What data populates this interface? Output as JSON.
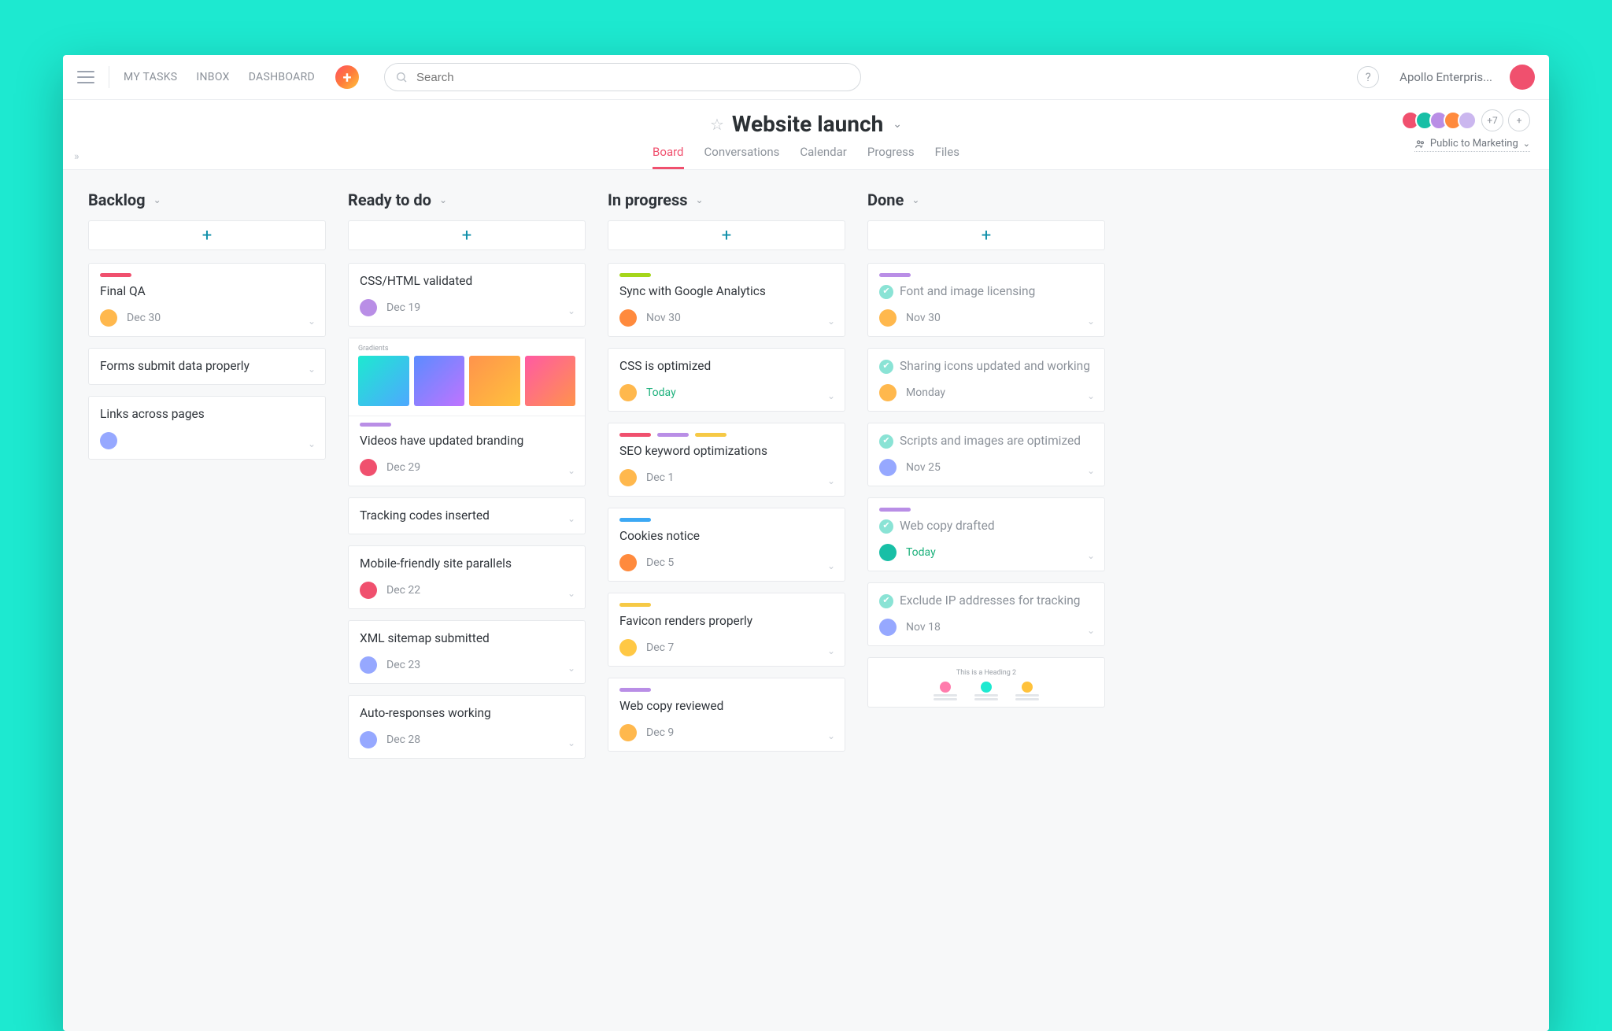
{
  "nav": {
    "my_tasks": "MY TASKS",
    "inbox": "INBOX",
    "dashboard": "DASHBOARD"
  },
  "search": {
    "placeholder": "Search"
  },
  "workspace": "Apollo Enterpris...",
  "project": {
    "title": "Website launch",
    "tabs": {
      "board": "Board",
      "conversations": "Conversations",
      "calendar": "Calendar",
      "progress": "Progress",
      "files": "Files"
    },
    "members_overflow": "+7",
    "visibility": "Public to Marketing"
  },
  "add_plus": "+",
  "columns": [
    {
      "title": "Backlog",
      "cards": [
        {
          "labels": [
            "red"
          ],
          "title": "Final QA",
          "avatar": "av-b",
          "date": "Dec 30"
        },
        {
          "labels": [],
          "title": "Forms submit data properly",
          "avatar": null,
          "date": ""
        },
        {
          "labels": [],
          "title": "Links across pages",
          "avatar": "av-e",
          "date": ""
        }
      ]
    },
    {
      "title": "Ready to do",
      "cards": [
        {
          "labels": [],
          "title": "CSS/HTML validated",
          "avatar": "av-f",
          "date": "Dec 19"
        },
        {
          "type": "gradients",
          "labels": [
            "purple"
          ],
          "title": "Videos have updated branding",
          "avatar": "av-a",
          "date": "Dec 29",
          "thumb_title": "Gradients"
        },
        {
          "labels": [],
          "title": "Tracking codes inserted",
          "avatar": null,
          "date": ""
        },
        {
          "labels": [],
          "title": "Mobile-friendly site parallels",
          "avatar": "av-a",
          "date": "Dec 22"
        },
        {
          "labels": [],
          "title": "XML sitemap submitted",
          "avatar": "av-e",
          "date": "Dec 23"
        },
        {
          "labels": [],
          "title": "Auto-responses working",
          "avatar": "av-e",
          "date": "Dec 28"
        }
      ]
    },
    {
      "title": "In progress",
      "cards": [
        {
          "labels": [
            "lime"
          ],
          "title": "Sync with Google Analytics",
          "avatar": "av-h",
          "date": "Nov 30"
        },
        {
          "labels": [],
          "title": "CSS is optimized",
          "avatar": "av-b",
          "date": "Today",
          "today": true
        },
        {
          "labels": [
            "red",
            "purple",
            "yellow"
          ],
          "title": "SEO keyword optimizations",
          "avatar": "av-b",
          "date": "Dec 1"
        },
        {
          "labels": [
            "blue"
          ],
          "title": "Cookies notice",
          "avatar": "av-h",
          "date": "Dec 5"
        },
        {
          "labels": [
            "yellow"
          ],
          "title": "Favicon renders properly",
          "avatar": "av-g",
          "date": "Dec 7"
        },
        {
          "labels": [
            "purple"
          ],
          "title": "Web copy reviewed",
          "avatar": "av-b",
          "date": "Dec 9"
        }
      ]
    },
    {
      "title": "Done",
      "cards": [
        {
          "done": true,
          "labels": [
            "purple"
          ],
          "title": "Font and image licensing",
          "avatar": "av-b",
          "date": "Nov 30"
        },
        {
          "done": true,
          "labels": [],
          "title": "Sharing icons updated and working",
          "avatar": "av-b",
          "date": "Monday"
        },
        {
          "done": true,
          "labels": [],
          "title": "Scripts and images are optimized",
          "avatar": "av-e",
          "date": "Nov 25"
        },
        {
          "done": true,
          "labels": [
            "purple"
          ],
          "title": "Web copy drafted",
          "avatar": "av-c",
          "date": "Today",
          "today": true
        },
        {
          "done": true,
          "labels": [],
          "title": "Exclude IP addresses for tracking",
          "avatar": "av-e",
          "date": "Nov 18"
        },
        {
          "type": "orgchart",
          "done": false,
          "labels": [],
          "title": "",
          "avatar": null,
          "date": "",
          "thumb_title": "This is a Heading 2"
        }
      ]
    }
  ]
}
